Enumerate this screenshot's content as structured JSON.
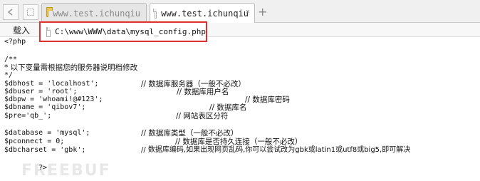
{
  "tabs": [
    {
      "label": "www.test.ichunqiu",
      "active": false
    },
    {
      "label": "www.test.ichunqiu",
      "active": true
    }
  ],
  "new_tab_symbol": "+",
  "address": {
    "load_label": "载入",
    "path": "C:\\www\\WWW\\data\\mysql_config.php"
  },
  "code": {
    "php_open": "<?php",
    "comment_start": "/**",
    "comment_desc": "* 以下变量需根据您的服务器说明档修改",
    "comment_end": "*/",
    "dbhost": {
      "code": "$dbhost = 'localhost';",
      "comment": "// 数据库服务器（一般不必改）"
    },
    "dbuser": {
      "code": "$dbuser = 'root';",
      "comment": "// 数据库用户名"
    },
    "dbpw": {
      "code": "$dbpw = 'whoami!@#123';",
      "comment": "// 数据库密码"
    },
    "dbname": {
      "code": "$dbname = 'qibov7';",
      "comment": "// 数据库名"
    },
    "pre": {
      "code": "$pre='qb_';",
      "comment": "// 网站表区分符"
    },
    "database": {
      "code": "$database = 'mysql';",
      "comment": "// 数据库类型（一般不必改）"
    },
    "pconnect": {
      "code": "$pconnect = 0;",
      "comment": "// 数据库是否持久连接（一般不必改）"
    },
    "dbcharset": {
      "code": "$dbcharset = 'gbk';",
      "comment": "// 数据库编码,如果出现网页乱码,你可以尝试改为gbk或latin1或utf8或big5,即可解决"
    },
    "php_close": "?>"
  },
  "watermark": "FREEBUF",
  "colors": {
    "highlight_border": "#e0322d",
    "folder": "#e7c552"
  }
}
